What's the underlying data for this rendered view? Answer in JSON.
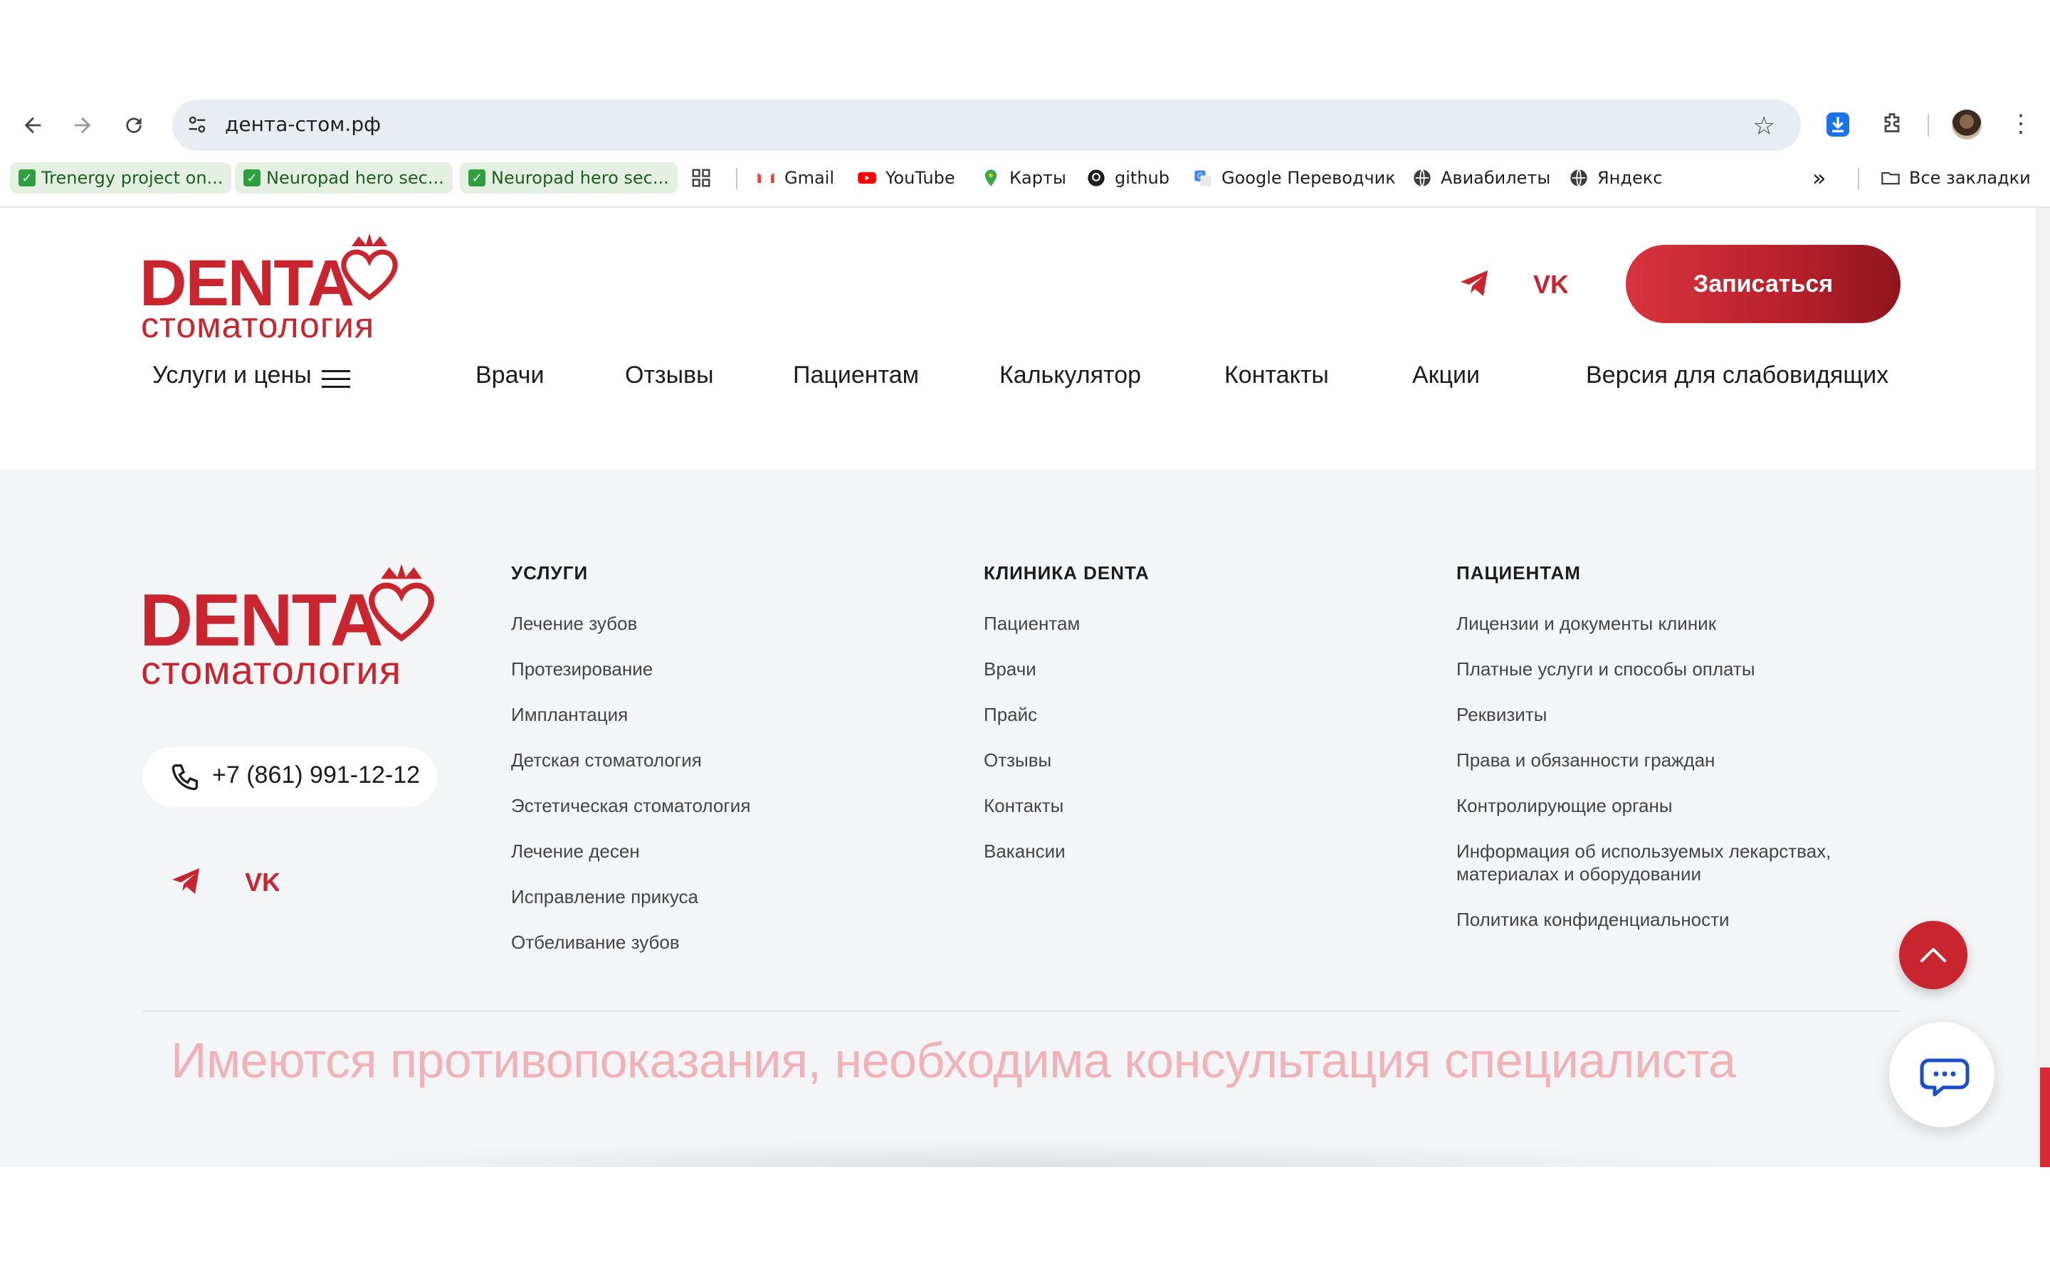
{
  "browser": {
    "url": "дента-стом.рф",
    "bookmarks": [
      {
        "label": "Trenergy project on..."
      },
      {
        "label": "Neuropad hero sec..."
      },
      {
        "label": "Neuropad hero sec..."
      },
      {
        "label": "Gmail"
      },
      {
        "label": "YouTube"
      },
      {
        "label": "Карты"
      },
      {
        "label": "github"
      },
      {
        "label": "Google Переводчик"
      },
      {
        "label": "Авиабилеты"
      },
      {
        "label": "Яндекс"
      }
    ],
    "all_bookmarks": "Все закладки",
    "overflow": "»"
  },
  "header": {
    "logo": {
      "main": "DENTA",
      "sub": "стоматология"
    },
    "cta": "Записаться",
    "nav": [
      "Услуги и цены",
      "Врачи",
      "Отзывы",
      "Пациентам",
      "Калькулятор",
      "Контакты",
      "Акции",
      "Версия для слабовидящих"
    ]
  },
  "footer": {
    "logo": {
      "main": "DENTA",
      "sub": "стоматология"
    },
    "phone": "+7 (861) 991-12-12",
    "columns": [
      {
        "title": "УСЛУГИ",
        "links": [
          "Лечение зубов",
          "Протезирование",
          "Имплантация",
          "Детская стоматология",
          "Эстетическая стоматология",
          "Лечение десен",
          "Исправление прикуса",
          "Отбеливание зубов"
        ]
      },
      {
        "title": "КЛИНИКА DENTA",
        "links": [
          "Пациентам",
          "Врачи",
          "Прайс",
          "Отзывы",
          "Контакты",
          "Вакансии"
        ]
      },
      {
        "title": "ПАЦИЕНТАМ",
        "links": [
          "Лицензии и документы клиник",
          "Платные услуги и способы оплаты",
          "Реквизиты",
          "Права и обязанности граждан",
          "Контролирующие органы",
          "Информация об используемых лекарствах,",
          "материалах и оборудовании",
          "Политика конфиденциальности"
        ]
      }
    ],
    "disclaimer": "Имеются противопоказания, необходима консультация специалиста"
  },
  "colors": {
    "brand": "#c9252f",
    "footer_bg": "#f4f5f7",
    "disclaimer": "#f0b2b7"
  }
}
